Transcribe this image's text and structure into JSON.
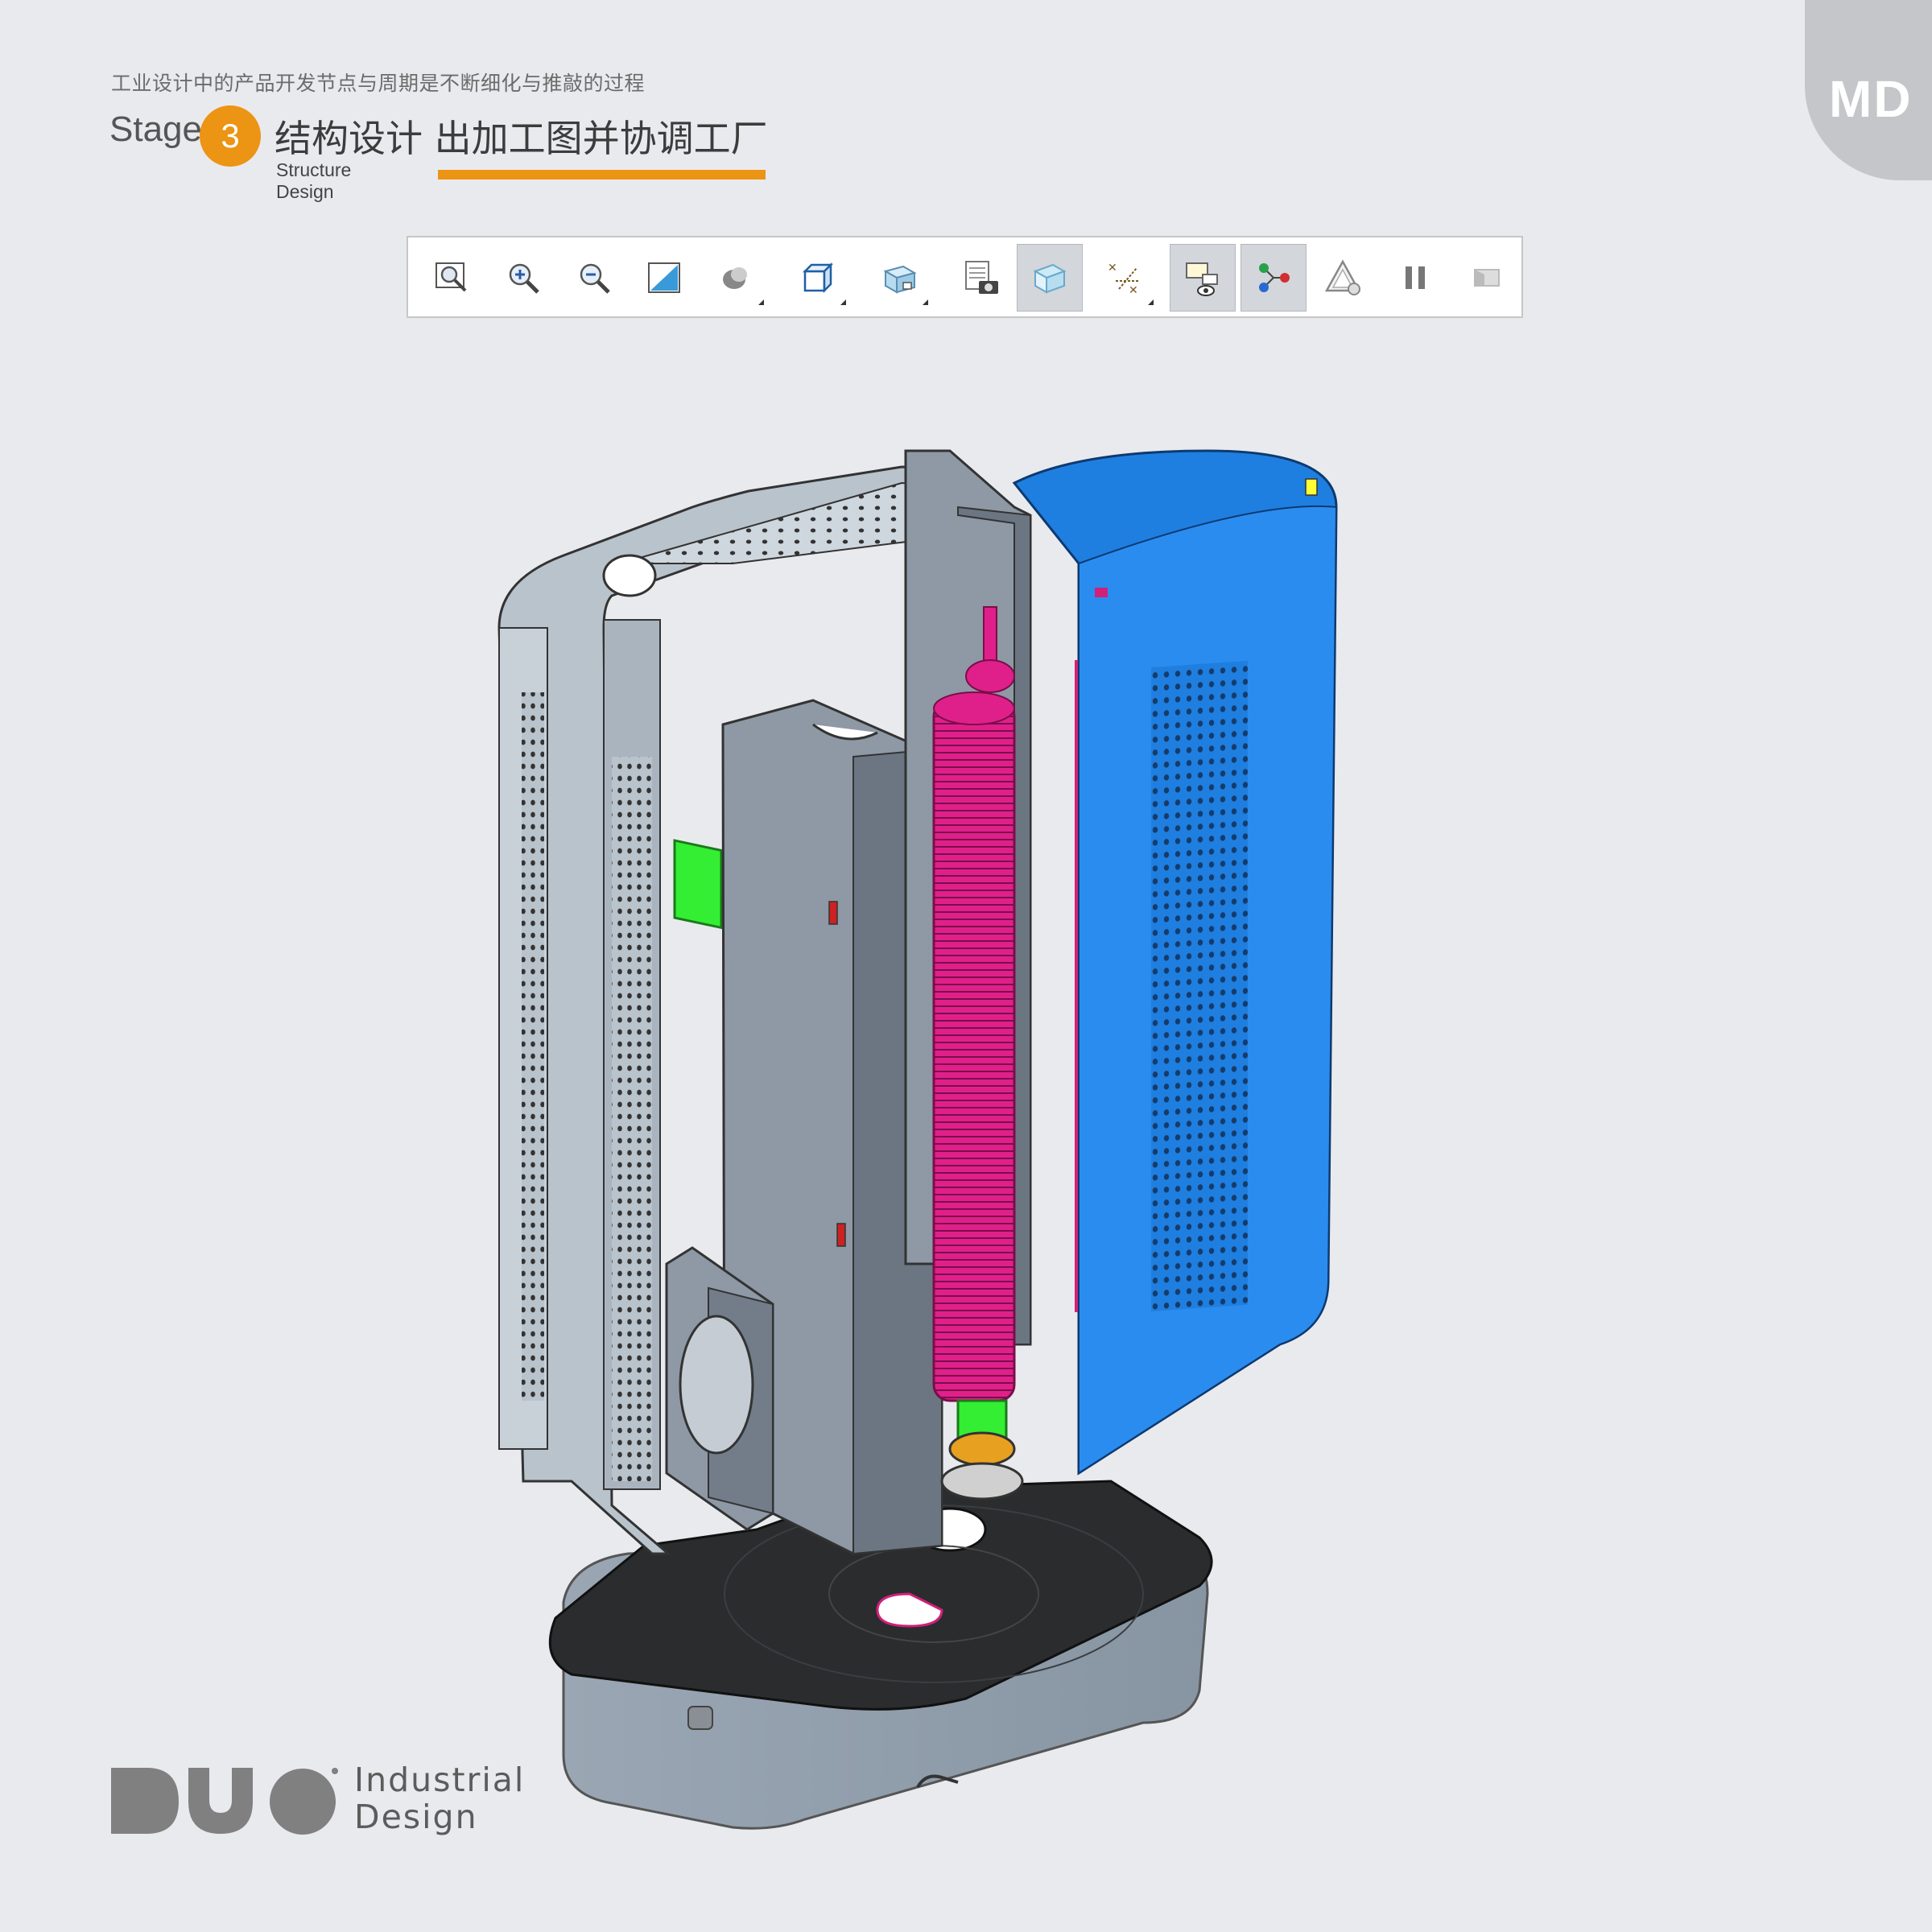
{
  "header": {
    "tagline": "工业设计中的产品开发节点与周期是不断细化与推敲的过程",
    "stage_word": "Stage",
    "stage_number": "3",
    "stage_title": "结构设计 出加工图并协调工厂",
    "stage_subtitle": "Structure Design",
    "accent_color": "#ec9413"
  },
  "badge": {
    "text": "MD"
  },
  "toolbar": {
    "buttons": [
      {
        "icon": "zoom-fit-icon"
      },
      {
        "icon": "zoom-in-icon"
      },
      {
        "icon": "zoom-out-icon"
      },
      {
        "icon": "zoom-window-icon"
      },
      {
        "icon": "shaded-display-icon",
        "has_dropdown": true
      },
      {
        "icon": "view-cube-icon",
        "has_dropdown": true
      },
      {
        "icon": "saved-views-icon",
        "has_dropdown": true
      },
      {
        "icon": "screenshot-icon"
      },
      {
        "icon": "transparency-icon",
        "active": true
      },
      {
        "icon": "datum-display-icon",
        "has_dropdown": true
      },
      {
        "icon": "visibility-icon",
        "active": true
      },
      {
        "icon": "explode-icon",
        "active": true
      },
      {
        "icon": "annotation-icon"
      },
      {
        "icon": "pause-icon"
      },
      {
        "icon": "step-icon"
      }
    ]
  },
  "model": {
    "description_colors": {
      "frame": "#b9c3cc",
      "housing": "#1f7fe0",
      "heater": "#e0208a",
      "base": "#2a2c2e",
      "bracket": "#8e99a5",
      "green_part": "#33ee33"
    }
  },
  "footer": {
    "logo_letters": "DUO",
    "logo_line1": "Industrial",
    "logo_line2": "Design"
  }
}
